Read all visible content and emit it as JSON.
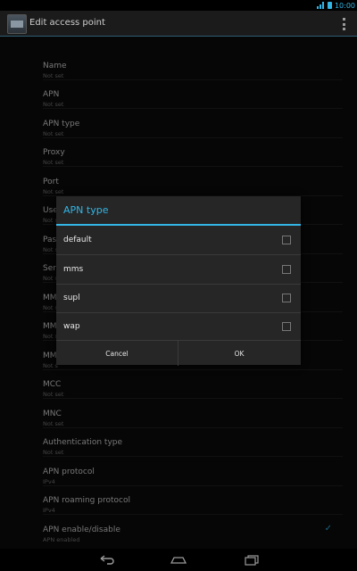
{
  "status": {
    "time": "10:00"
  },
  "actionbar": {
    "title": "Edit access point"
  },
  "prefs": [
    {
      "title": "Name",
      "summary": "Not set"
    },
    {
      "title": "APN",
      "summary": "Not set"
    },
    {
      "title": "APN type",
      "summary": "Not set"
    },
    {
      "title": "Proxy",
      "summary": "Not set"
    },
    {
      "title": "Port",
      "summary": "Not set"
    },
    {
      "title": "Use",
      "summary": "Not set"
    },
    {
      "title": "Pas",
      "summary": "Not set"
    },
    {
      "title": "Serv",
      "summary": "Not set"
    },
    {
      "title": "MM",
      "summary": "Not s"
    },
    {
      "title": "MM",
      "summary": "Not s"
    },
    {
      "title": "MM",
      "summary": "Not s"
    },
    {
      "title": "MCC",
      "summary": "Not set"
    },
    {
      "title": "MNC",
      "summary": "Not set"
    },
    {
      "title": "Authentication type",
      "summary": "Not set"
    },
    {
      "title": "APN protocol",
      "summary": "IPv4"
    },
    {
      "title": "APN roaming protocol",
      "summary": "IPv4"
    },
    {
      "title": "APN enable/disable",
      "summary": "APN enabled"
    }
  ],
  "dialog": {
    "title": "APN type",
    "options": [
      {
        "label": "default"
      },
      {
        "label": "mms"
      },
      {
        "label": "supl"
      },
      {
        "label": "wap"
      }
    ],
    "cancel_label": "Cancel",
    "ok_label": "OK"
  },
  "colors": {
    "accent": "#33b5e5"
  },
  "icons": [
    "signal-icon",
    "battery-icon",
    "overflow-menu-icon",
    "back-icon",
    "home-icon",
    "recent-apps-icon",
    "checkmark-icon"
  ]
}
